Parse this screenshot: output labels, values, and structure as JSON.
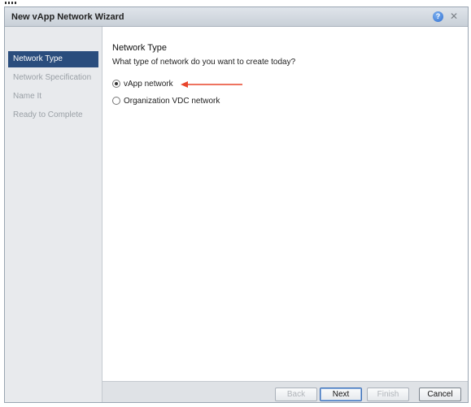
{
  "dialog": {
    "title": "New vApp Network Wizard"
  },
  "titlebar": {
    "help_glyph": "?",
    "close_glyph": "✕",
    "help_icon": "help-icon",
    "close_icon": "close-icon"
  },
  "sidebar": {
    "items": [
      {
        "label": "Network Type",
        "active": true
      },
      {
        "label": "Network Specification",
        "active": false
      },
      {
        "label": "Name It",
        "active": false
      },
      {
        "label": "Ready to Complete",
        "active": false
      }
    ]
  },
  "main": {
    "section_title": "Network Type",
    "question": "What type of network do you want to create today?",
    "options": [
      {
        "label": "vApp network",
        "selected": true
      },
      {
        "label": "Organization VDC network",
        "selected": false
      }
    ]
  },
  "footer": {
    "back_label": "Back",
    "next_label": "Next",
    "finish_label": "Finish",
    "cancel_label": "Cancel"
  },
  "colors": {
    "annotation_arrow": "#e8452c",
    "sidebar_active_bg": "#2a4d7d"
  }
}
